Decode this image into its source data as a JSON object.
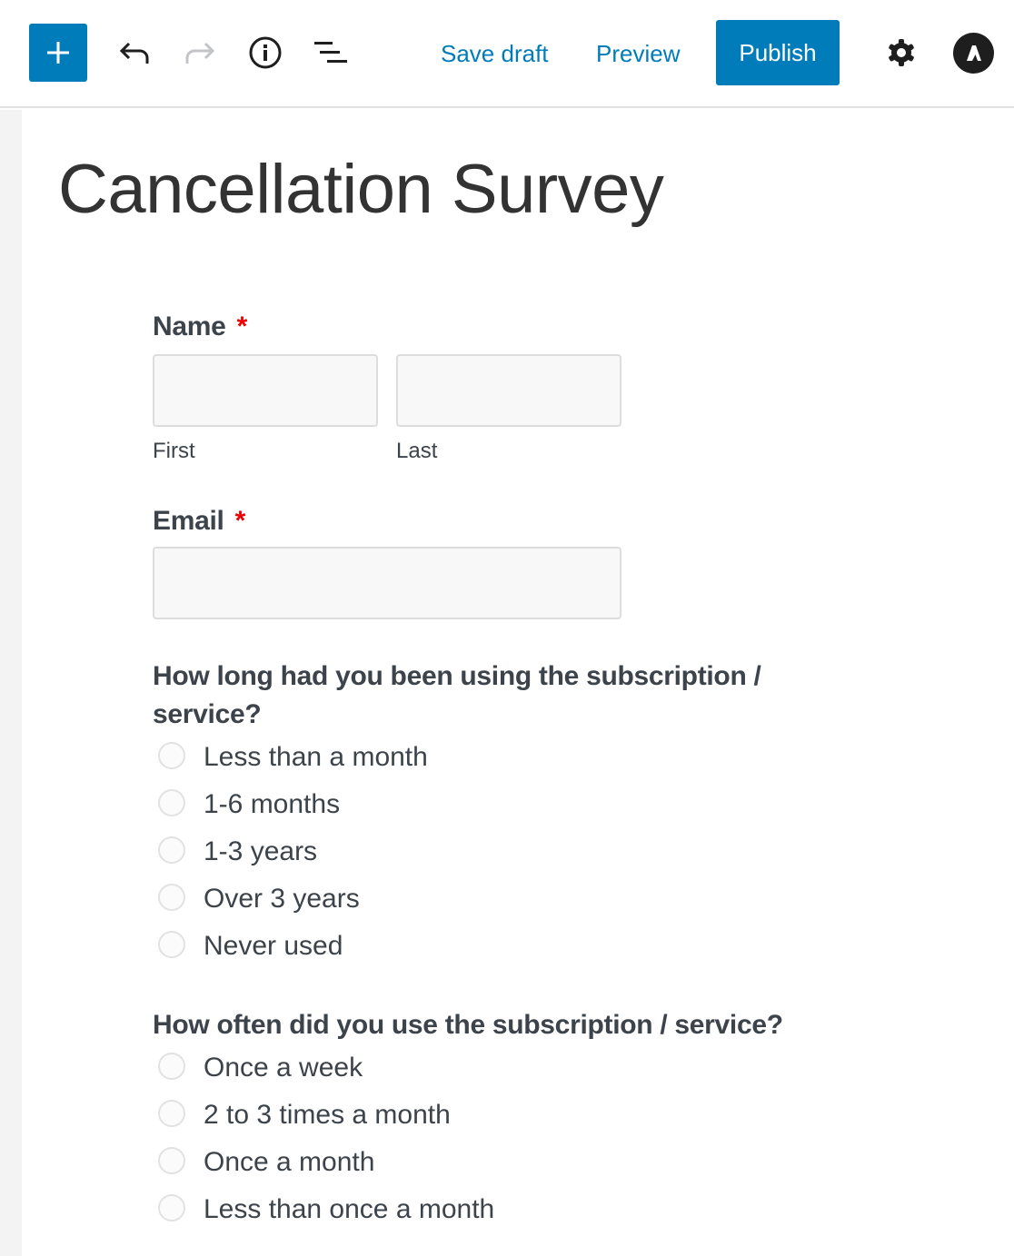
{
  "toolbar": {
    "add_block_icon": "plus-icon",
    "undo_icon": "undo-icon",
    "redo_icon": "redo-icon",
    "info_icon": "info-icon",
    "outline_icon": "list-view-icon",
    "save_draft_label": "Save draft",
    "preview_label": "Preview",
    "publish_label": "Publish",
    "settings_icon": "gear-icon",
    "plugin_icon": "astra-logo-icon",
    "accent_color": "#007cba"
  },
  "page": {
    "title": "Cancellation Survey"
  },
  "form": {
    "name": {
      "label": "Name",
      "required_marker": "*",
      "first_sublabel": "First",
      "last_sublabel": "Last",
      "first_value": "",
      "last_value": ""
    },
    "email": {
      "label": "Email",
      "required_marker": "*",
      "value": ""
    },
    "questions": [
      {
        "title": "How long had you been using the subscription / service?",
        "options": [
          {
            "label": "Less than a month",
            "selected": false
          },
          {
            "label": "1-6 months",
            "selected": false
          },
          {
            "label": "1-3 years",
            "selected": false
          },
          {
            "label": "Over 3 years",
            "selected": false
          },
          {
            "label": "Never used",
            "selected": false
          }
        ]
      },
      {
        "title": "How often did you use the subscription / service?",
        "options": [
          {
            "label": "Once a week",
            "selected": false
          },
          {
            "label": "2 to 3 times a month",
            "selected": false
          },
          {
            "label": "Once a month",
            "selected": false
          },
          {
            "label": "Less than once a month",
            "selected": false
          }
        ]
      }
    ]
  }
}
